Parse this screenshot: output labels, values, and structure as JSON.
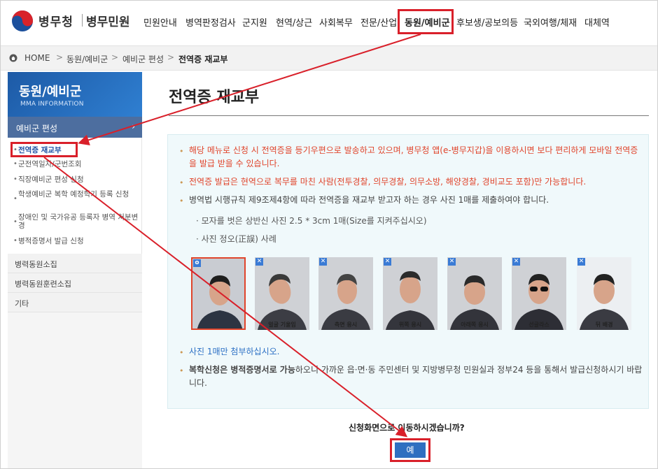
{
  "header": {
    "brand_primary": "병무청",
    "brand_secondary": "병무민원",
    "nav": [
      "민원안내",
      "병역판정검사",
      "군지원",
      "현역/상근",
      "사회복무",
      "전문/산업",
      "동원/예비군",
      "후보생/공보의등",
      "국외여행/체재",
      "대체역"
    ]
  },
  "breadcrumb": [
    "HOME",
    "동원/예비군",
    "예비군 편성",
    "전역증 재교부"
  ],
  "sidebar": {
    "title": "동원/예비군",
    "subtitle": "MMA INFORMATION",
    "active_section": "예비군 편성",
    "submenu": [
      "전역증 재교부",
      "군전역일자/군번조회",
      "직장예비군 편성 신청",
      "학생예비군 복학 예정학기 등록 신청",
      "장애인 및 국가유공 등록자 병역 처분변경",
      "병적증명서 발급 신청"
    ],
    "sections": [
      "병력동원소집",
      "병력동원훈련소집",
      "기타"
    ]
  },
  "content": {
    "title": "전역증 재교부",
    "notice1": "해당 메뉴로 신청 시 전역증을 등기우편으로 발송하고 있으며, 병무청 앱(e-병무지갑)을 이용하시면 보다 편리하게 모바일 전역증을 발급 받을 수 있습니다.",
    "notice2": "전역증 발급은 현역으로 복무를 마친 사람(전투경찰, 의무경찰, 의무소방, 해양경찰, 경비교도 포함)만 가능합니다.",
    "notice3": "병역법 시행규칙 제9조제4항에 따라 전역증을 재교부 받고자 하는 경우 사진 1매를 제출하여야 합니다.",
    "sub1": "모자를 벗은 상반신 사진 2.5 * 3cm 1매(Size를 지켜주십시오)",
    "sub2": "사진 정오(正誤) 사례",
    "photo_captions": [
      "",
      "얼굴 기울임",
      "측면 응시",
      "위쪽 응시",
      "아래쪽 응시",
      "선글라스",
      "뒤 배경"
    ],
    "notice4": "사진 1매만 첨부하십시오.",
    "notice5_bold": "복학신청은 병적증명서로 가능",
    "notice5_rest": "하오니 가까운 읍·면·동 주민센터 및 지방병무청 민원실과 정부24 등을 통해서 발급신청하시기 바랍니다."
  },
  "confirm": {
    "question": "신청화면으로 이동하시겠습니까?",
    "yes_label": "예"
  }
}
